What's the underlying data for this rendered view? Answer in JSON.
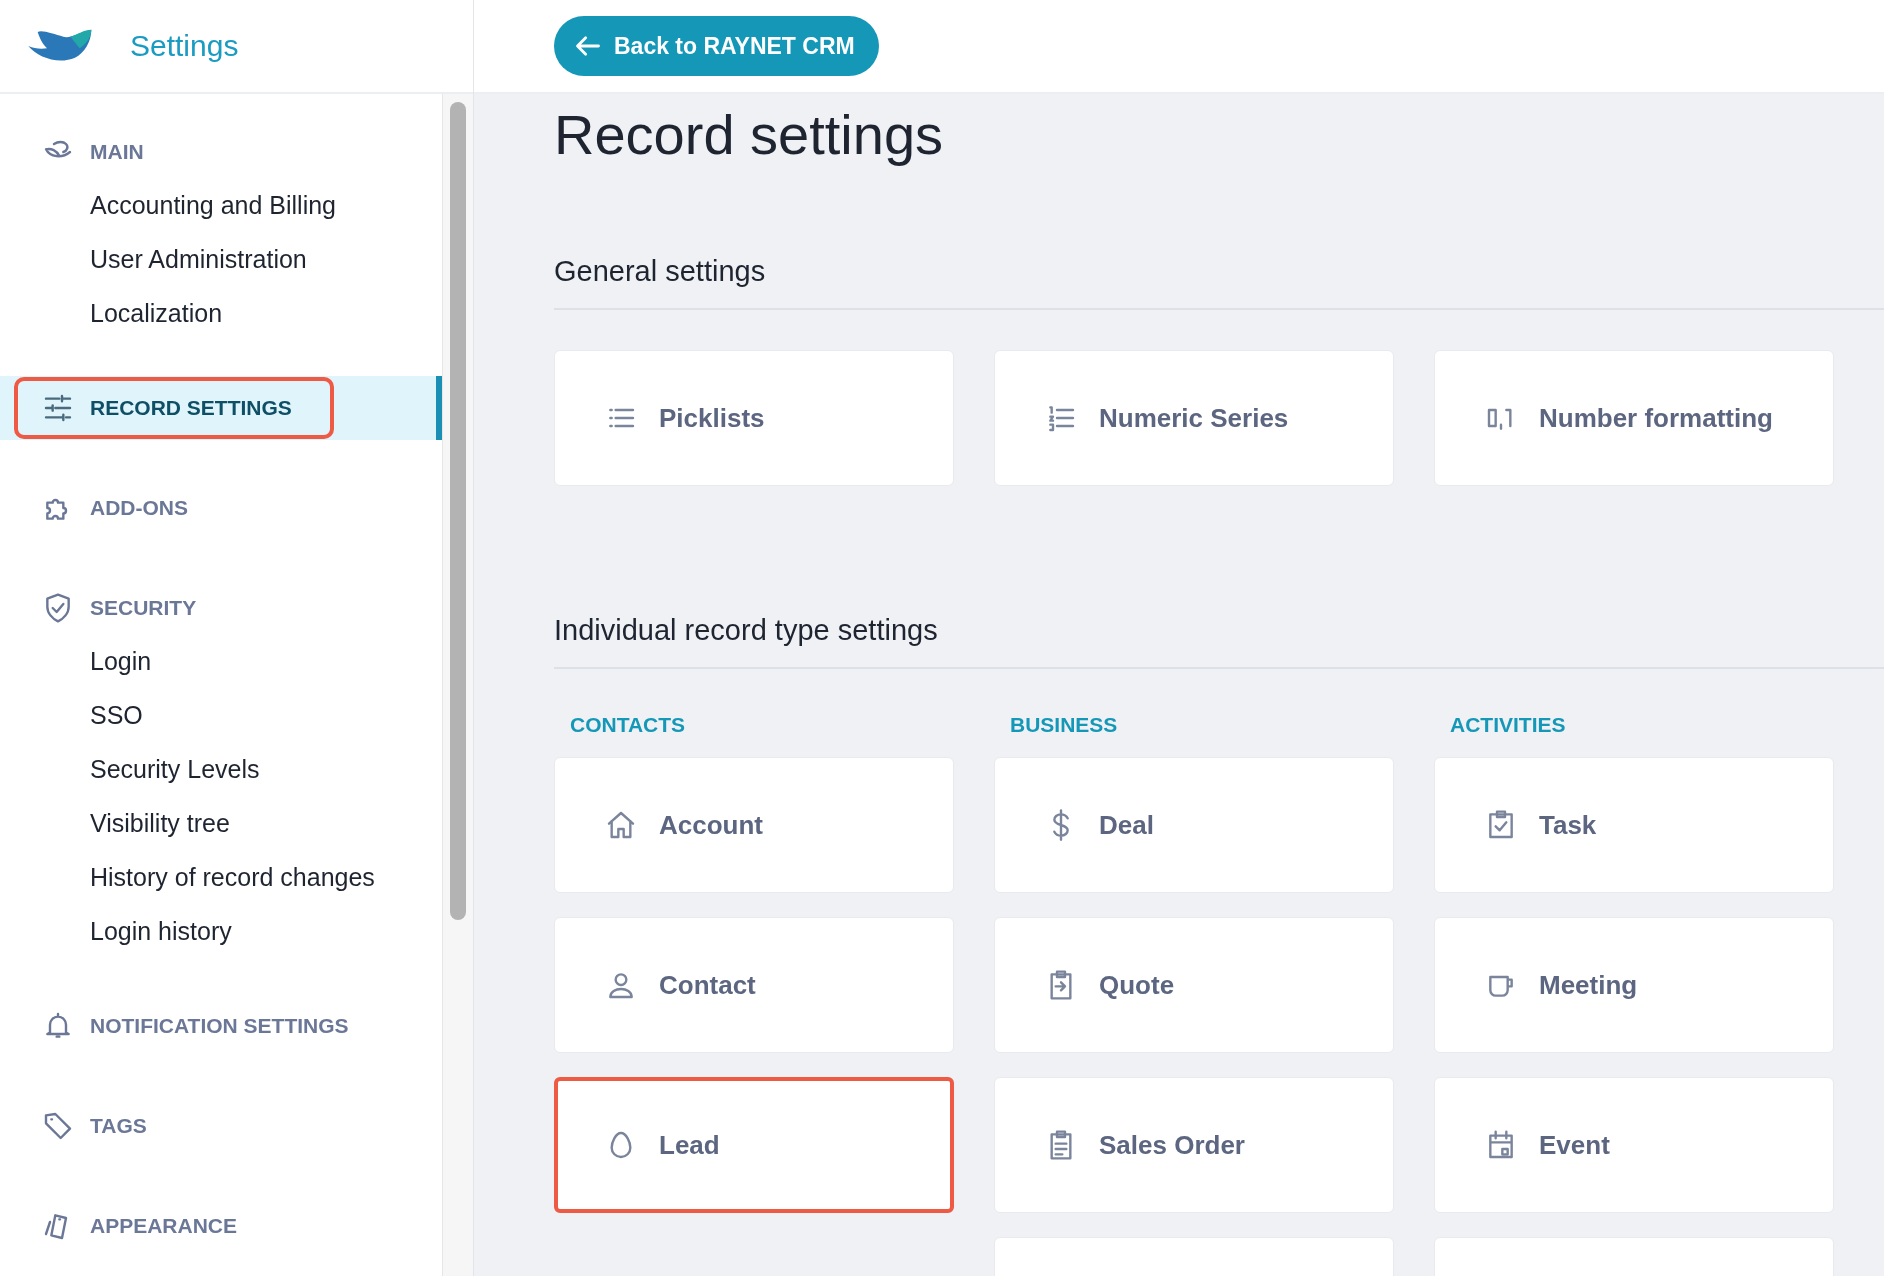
{
  "app": {
    "title": "Settings"
  },
  "sidebar": {
    "sections": [
      {
        "label": "MAIN",
        "selected": false,
        "highlighted": false,
        "items": [
          "Accounting and Billing",
          "User Administration",
          "Localization"
        ]
      },
      {
        "label": "RECORD SETTINGS",
        "selected": true,
        "highlighted": true
      },
      {
        "label": "ADD-ONS",
        "selected": false,
        "highlighted": false
      },
      {
        "label": "SECURITY",
        "selected": false,
        "highlighted": false,
        "items": [
          "Login",
          "SSO",
          "Security Levels",
          "Visibility tree",
          "History of record changes",
          "Login history"
        ]
      },
      {
        "label": "NOTIFICATION SETTINGS",
        "selected": false,
        "highlighted": false
      },
      {
        "label": "TAGS",
        "selected": false,
        "highlighted": false
      },
      {
        "label": "APPEARANCE",
        "selected": false,
        "highlighted": false
      }
    ]
  },
  "back_button": "Back to RAYNET CRM",
  "page_title": "Record settings",
  "general": {
    "heading": "General settings",
    "cards": [
      {
        "label": "Picklists",
        "highlighted": false
      },
      {
        "label": "Numeric Series",
        "highlighted": false
      },
      {
        "label": "Number formatting",
        "highlighted": false
      }
    ]
  },
  "individual": {
    "heading": "Individual record type settings",
    "columns": [
      {
        "label": "CONTACTS",
        "cards": [
          {
            "kind": "card",
            "label": "Account",
            "highlighted": false
          },
          {
            "kind": "card",
            "label": "Contact",
            "highlighted": false
          },
          {
            "kind": "card",
            "label": "Lead",
            "highlighted": true
          }
        ]
      },
      {
        "label": "BUSINESS",
        "cards": [
          {
            "kind": "card",
            "label": "Deal",
            "highlighted": false
          },
          {
            "kind": "card",
            "label": "Quote",
            "highlighted": false
          },
          {
            "kind": "card",
            "label": "Sales Order",
            "highlighted": false
          },
          {
            "kind": "cut"
          }
        ]
      },
      {
        "label": "ACTIVITIES",
        "cards": [
          {
            "kind": "card",
            "label": "Task",
            "highlighted": false
          },
          {
            "kind": "card",
            "label": "Meeting",
            "highlighted": false
          },
          {
            "kind": "card",
            "label": "Event",
            "highlighted": false
          },
          {
            "kind": "cut"
          }
        ]
      }
    ]
  }
}
